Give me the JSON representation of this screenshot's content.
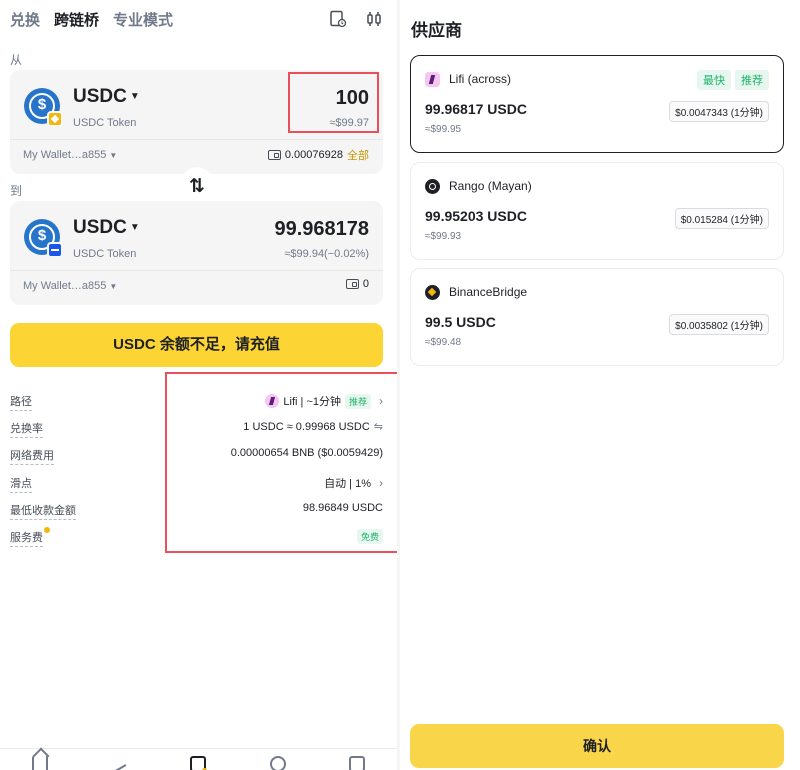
{
  "tabs": [
    {
      "label": "兑换"
    },
    {
      "label": "跨链桥"
    },
    {
      "label": "专业模式"
    }
  ],
  "icons": {
    "history": "history-icon",
    "settings": "settings-icon"
  },
  "from": {
    "label": "从",
    "coin": "USDC",
    "token_name": "USDC Token",
    "amount": "100",
    "amount_usd": "≈$99.97",
    "wallet": "My Wallet…a855",
    "balance": "0.00076928",
    "all_label": "全部",
    "chain": "BNB Chain"
  },
  "to": {
    "label": "到",
    "coin": "USDC",
    "token_name": "USDC Token",
    "amount": "99.968178",
    "amount_usd": "≈$99.94(−0.02%)",
    "wallet": "My Wallet…a855",
    "balance": "0",
    "chain": "Solana"
  },
  "swap_symbol": "⇅",
  "cta_label": "USDC 余额不足，请充值",
  "details": {
    "route": {
      "key": "路径",
      "value": "Lifi | ~1分钟",
      "tag": "推荐"
    },
    "rate": {
      "key": "兑换率",
      "value": "1 USDC ≈ 0.99968 USDC",
      "swap_glyph": "⇋"
    },
    "network_fee": {
      "key": "网络费用",
      "value": "0.00000654 BNB ($0.0059429)"
    },
    "slippage": {
      "key": "滑点",
      "value": "自动 | 1%"
    },
    "min_receive": {
      "key": "最低收款金额",
      "value": "98.96849 USDC"
    },
    "service_fee": {
      "key": "服务费",
      "value": "免费"
    }
  },
  "chevron": "›",
  "right_panel": {
    "title": "供应商",
    "providers": [
      {
        "name": "Lifi (across)",
        "tags": [
          "最快",
          "推荐"
        ],
        "amount": "99.96817 USDC",
        "usd": "≈$99.95",
        "fee": "$0.0047343 (1分钟)",
        "selected": true
      },
      {
        "name": "Rango (Mayan)",
        "tags": [],
        "amount": "99.95203 USDC",
        "usd": "≈$99.93",
        "fee": "$0.015284 (1分钟)",
        "selected": false
      },
      {
        "name": "BinanceBridge",
        "tags": [],
        "amount": "99.5 USDC",
        "usd": "≈$99.48",
        "fee": "$0.0035802 (1分钟)",
        "selected": false
      }
    ],
    "confirm_label": "确认"
  },
  "colors": {
    "accent": "#fcd535",
    "highlight_border": "#e8505b",
    "usdc_blue": "#2775ca",
    "positive": "#20b26c"
  }
}
